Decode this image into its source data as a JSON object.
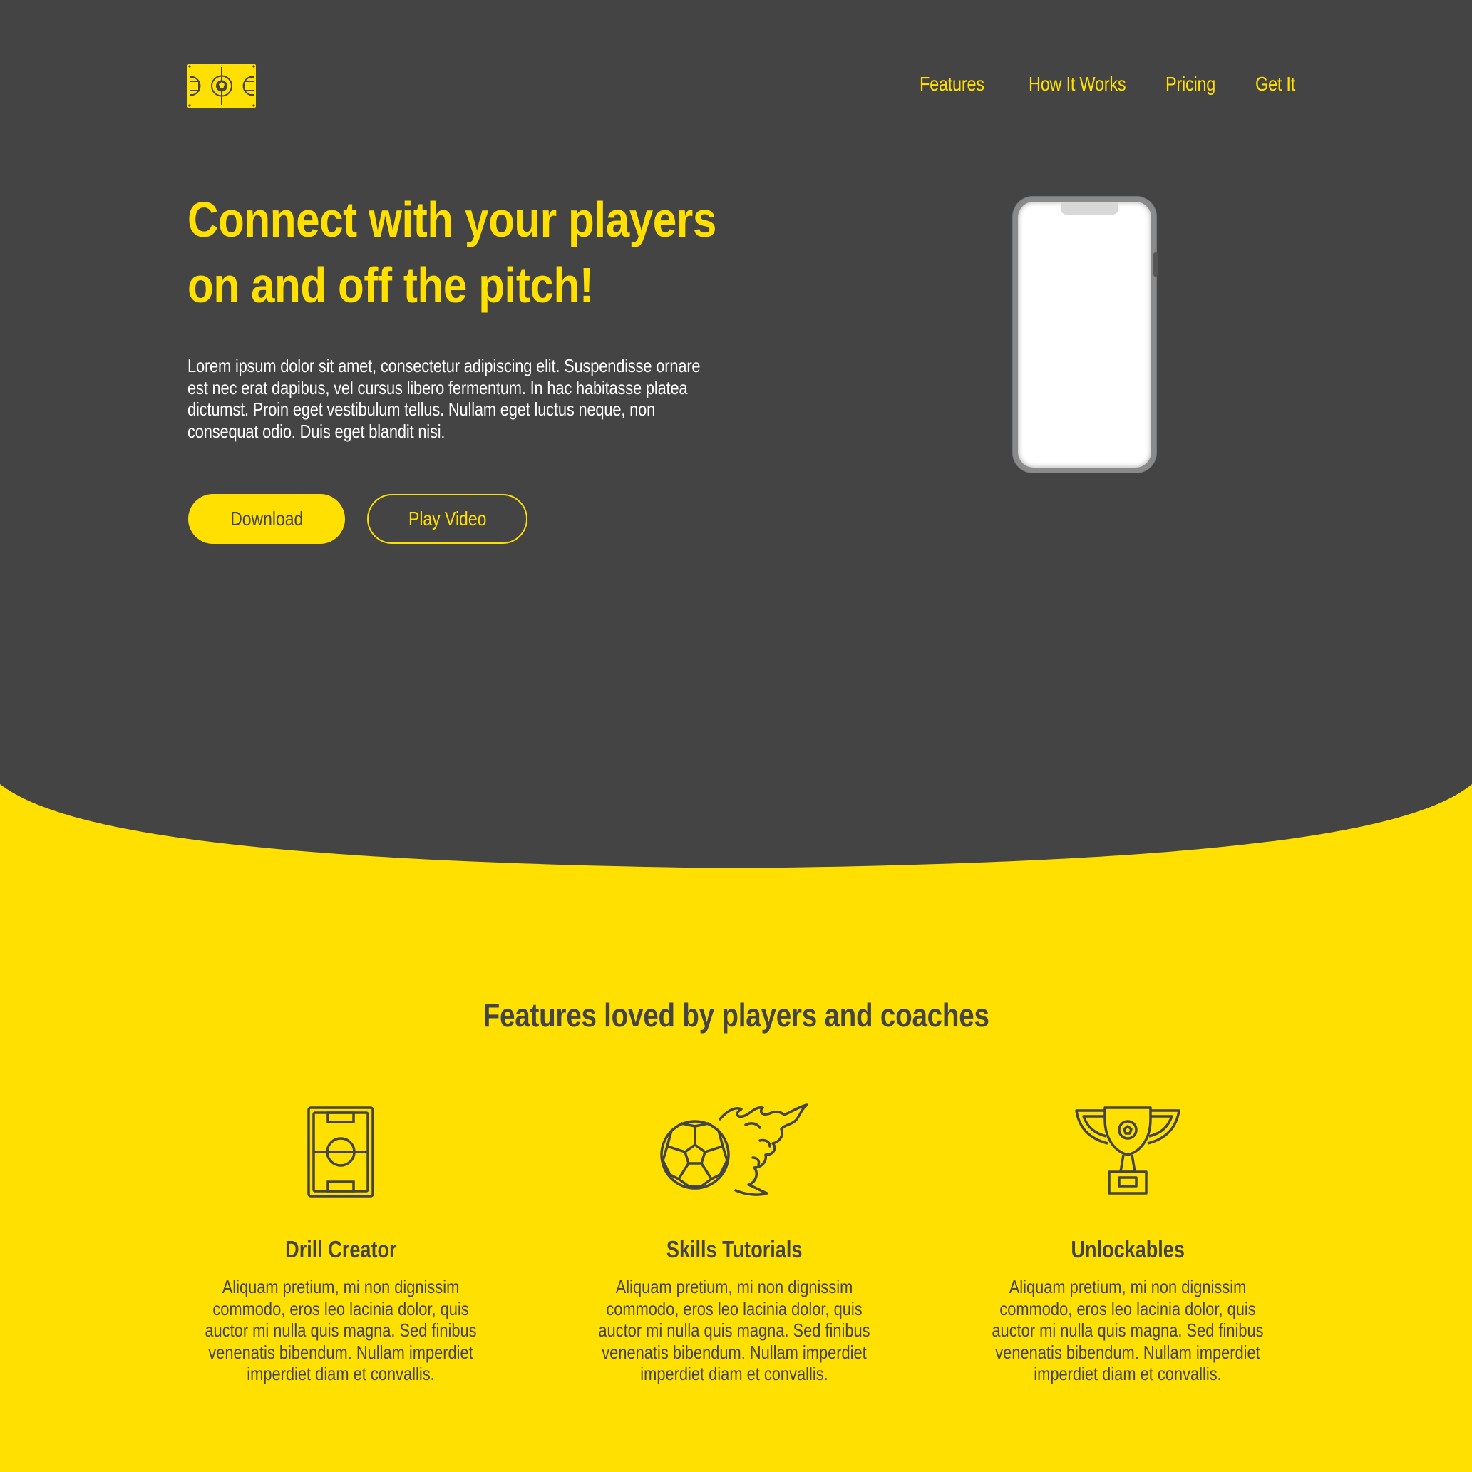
{
  "colors": {
    "dark": "#444444",
    "accent": "#FFE000",
    "white": "#FFFFFF"
  },
  "header": {
    "logo_icon": "football-pitch-icon",
    "nav": [
      {
        "label": "Features"
      },
      {
        "label": "How It Works"
      },
      {
        "label": "Pricing"
      },
      {
        "label": "Get It"
      }
    ]
  },
  "hero": {
    "title": "Connect with your players on and off the pitch!",
    "body": "Lorem ipsum dolor sit amet, consectetur adipiscing elit. Suspendisse ornare est nec erat dapibus, vel cursus libero fermentum. In hac habitasse platea dictumst. Proin eget vestibulum tellus. Nullam eget luctus neque, non consequat odio. Duis eget blandit nisi.",
    "download_label": "Download",
    "play_video_label": "Play Video",
    "device_icon": "smartphone-icon"
  },
  "features": {
    "title": "Features loved by players and coaches",
    "items": [
      {
        "icon": "pitch-board-icon",
        "title": "Drill Creator",
        "body": "Aliquam pretium, mi non dignissim commodo, eros leo lacinia dolor, quis auctor mi nulla quis magna. Sed finibus venenatis bibendum. Nullam imperdiet imperdiet diam et convallis."
      },
      {
        "icon": "flaming-football-icon",
        "title": "Skills Tutorials",
        "body": "Aliquam pretium, mi non dignissim commodo, eros leo lacinia dolor, quis auctor mi nulla quis magna. Sed finibus venenatis bibendum. Nullam imperdiet imperdiet diam et convallis."
      },
      {
        "icon": "trophy-icon",
        "title": "Unlockables",
        "body": "Aliquam pretium, mi non dignissim commodo, eros leo lacinia dolor, quis auctor mi nulla quis magna. Sed finibus venenatis bibendum. Nullam imperdiet imperdiet diam et convallis."
      }
    ]
  }
}
